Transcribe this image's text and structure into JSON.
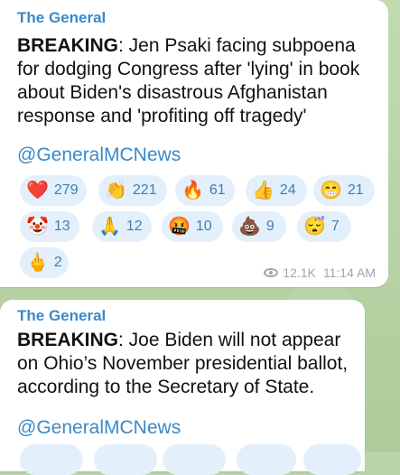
{
  "colors": {
    "background": "#b9d4a8",
    "bubble": "#ffffff",
    "accent": "#3a89c9",
    "chip": "#e3f0fb",
    "chip_text": "#3f7fb3",
    "meta": "#9aa8b4"
  },
  "messages": [
    {
      "sender": "The General",
      "lead": "BREAKING",
      "text": ": Jen Psaki facing subpoena for dodging Congress after 'lying' in book about Biden's disastrous Afghanistan response and 'profiting off tragedy'",
      "handle": "@GeneralMCNews",
      "reactions": [
        {
          "emoji": "❤️",
          "count": "279"
        },
        {
          "emoji": "👏",
          "count": "221"
        },
        {
          "emoji": "🔥",
          "count": "61"
        },
        {
          "emoji": "👍",
          "count": "24"
        },
        {
          "emoji": "😁",
          "count": "21"
        },
        {
          "emoji": "🤡",
          "count": "13"
        },
        {
          "emoji": "🙏",
          "count": "12"
        },
        {
          "emoji": "🤬",
          "count": "10"
        },
        {
          "emoji": "💩",
          "count": "9"
        },
        {
          "emoji": "😴",
          "count": "7"
        },
        {
          "emoji": "🖕",
          "count": "2"
        }
      ],
      "views": "12.1K",
      "time": "11:14 AM"
    },
    {
      "sender": "The General",
      "lead": "BREAKING",
      "text": ": Joe Biden will not appear on Ohio’s November presidential ballot, according to the Secretary of State.",
      "handle": "@GeneralMCNews"
    }
  ]
}
